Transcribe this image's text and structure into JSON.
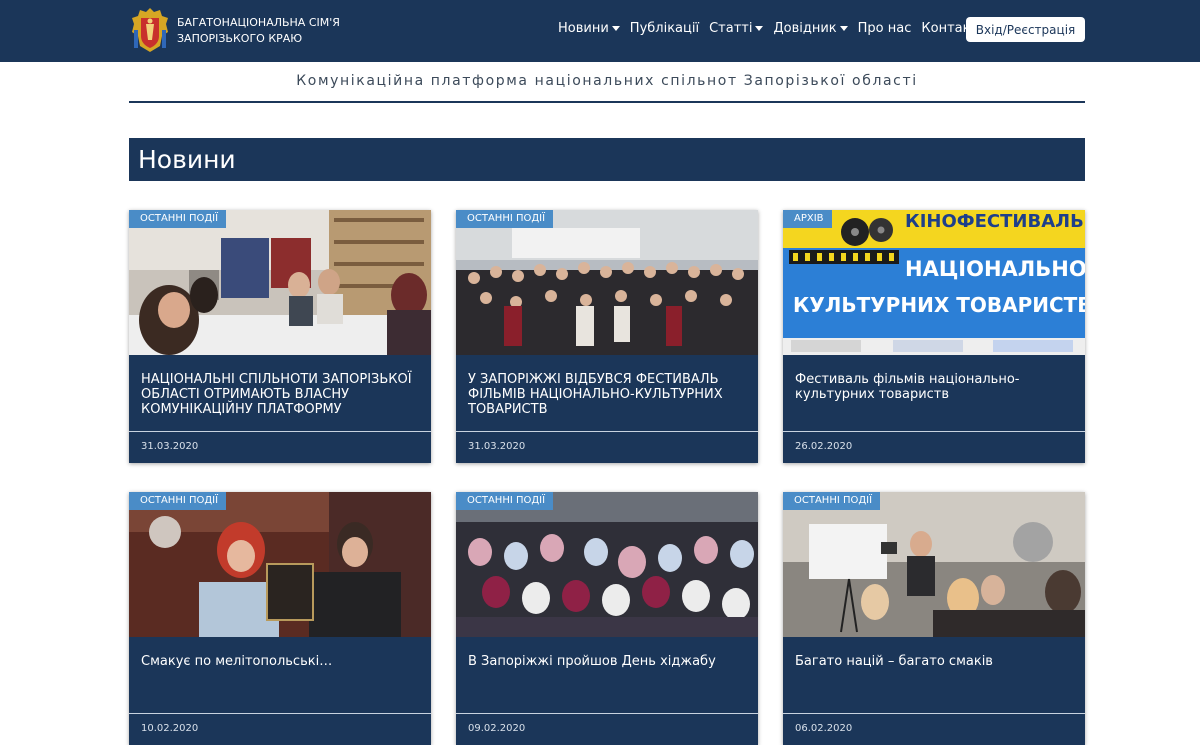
{
  "header": {
    "brand_line1": "БАГАТОНАЦІОНАЛЬНА СІМ'Я",
    "brand_line2": "ЗАПОРІЗЬКОГО КРАЮ",
    "logo_icon": "coat-of-arms-icon",
    "nav": [
      {
        "label": "Новини",
        "dropdown": true
      },
      {
        "label": "Публікації",
        "dropdown": false
      },
      {
        "label": "Статті",
        "dropdown": true
      },
      {
        "label": "Довідник",
        "dropdown": true
      },
      {
        "label": "Про нас",
        "dropdown": false
      },
      {
        "label": "Контакти",
        "dropdown": false
      }
    ],
    "login_label": "Вхід/Реєстрація"
  },
  "tagline": "Комунікаційна платформа національних спільнот Запорізької області",
  "section_title": "Новини",
  "colors": {
    "navy": "#1b3659",
    "badge_blue": "#4a8cc7"
  },
  "cards": [
    {
      "badge": "ОСТАННІ ПОДІЇ",
      "title": "НАЦІОНАЛЬНІ СПІЛЬНОТИ ЗАПОРІЗЬКОЇ ОБЛАСТІ ОТРИМАЮТЬ ВЛАСНУ КОМУНІКАЦІЙНУ ПЛАТФОРМУ",
      "date": "31.03.2020"
    },
    {
      "badge": "ОСТАННІ ПОДІЇ",
      "title": "У ЗАПОРІЖЖІ ВІДБУВСЯ ФЕСТИВАЛЬ ФІЛЬМІВ НАЦІОНАЛЬНО-КУЛЬТУРНИХ ТОВАРИСТВ",
      "date": "31.03.2020"
    },
    {
      "badge": "АРХІВ",
      "title": "Фестиваль фільмів національно-культурних товариств",
      "date": "26.02.2020",
      "poster": {
        "line1": "КІНОФЕСТИВАЛЬ",
        "line2": "НАЦІОНАЛЬНО-",
        "line3": "КУЛЬТУРНИХ ТОВАРИСТВ"
      }
    },
    {
      "badge": "ОСТАННІ ПОДІЇ",
      "title": "Смакує по мелітопольські…",
      "date": "10.02.2020"
    },
    {
      "badge": "ОСТАННІ ПОДІЇ",
      "title": "В Запоріжжі пройшов День хіджабу",
      "date": "09.02.2020"
    },
    {
      "badge": "ОСТАННІ ПОДІЇ",
      "title": "Багато націй – багато смаків",
      "date": "06.02.2020"
    }
  ]
}
